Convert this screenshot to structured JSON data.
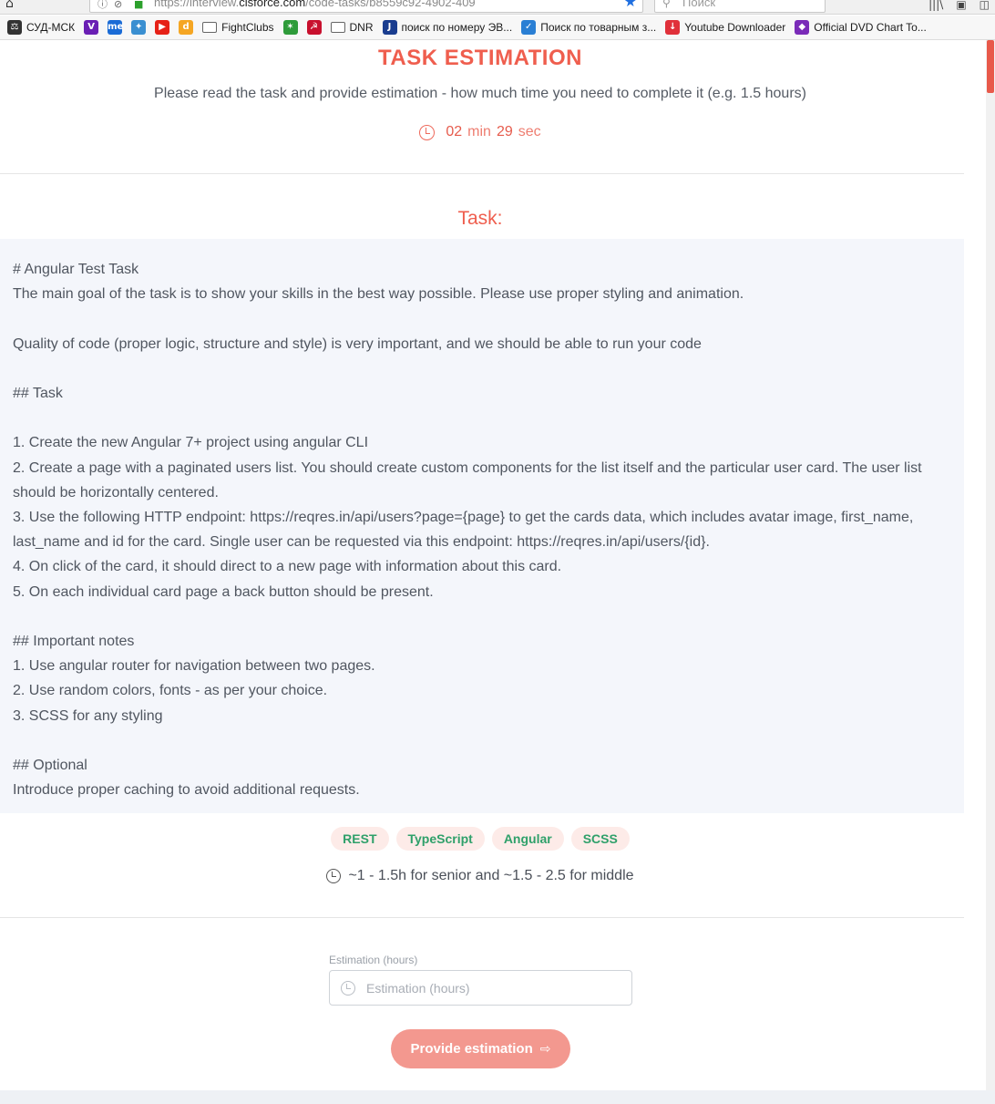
{
  "browser": {
    "url_prefix": "https://interview.",
    "url_domain": "cisforce.com",
    "url_rest": "/code-tasks/b8559c92-4902-409",
    "search_placeholder": "Поиск",
    "bookmarks": [
      {
        "label": "СУД-МСК",
        "icon": "court-icon",
        "color": "#333333"
      },
      {
        "label": "",
        "icon": "vp-icon",
        "color": "#6a1fb4"
      },
      {
        "label": "",
        "icon": "me-icon",
        "color": "#1a6bd6"
      },
      {
        "label": "",
        "icon": "puzzle-icon",
        "color": "#3a8fd1"
      },
      {
        "label": "",
        "icon": "youtube-icon",
        "color": "#e62117"
      },
      {
        "label": "",
        "icon": "d-icon",
        "color": "#f5a623"
      },
      {
        "label": "FightClubs",
        "icon": "folder-icon",
        "color": "#666666"
      },
      {
        "label": "",
        "icon": "star-flag-icon",
        "color": "#2e9b3a"
      },
      {
        "label": "",
        "icon": "emblem-icon",
        "color": "#c8102e"
      },
      {
        "label": "DNR",
        "icon": "folder-icon",
        "color": "#666666"
      },
      {
        "label": "поиск по номеру ЭВ...",
        "icon": "j-icon",
        "color": "#1a3d8f"
      },
      {
        "label": "Поиск по товарным з...",
        "icon": "shield-icon",
        "color": "#2a7fd4"
      },
      {
        "label": "Youtube Downloader",
        "icon": "download-icon",
        "color": "#e0303a"
      },
      {
        "label": "Official DVD Chart To...",
        "icon": "chart-icon",
        "color": "#7a2bb8"
      }
    ]
  },
  "header": {
    "title": "TASK ESTIMATION",
    "subtitle": "Please read the task and provide estimation - how much time you need to complete it (e.g. 1.5 hours)",
    "timer": {
      "minutes": "02",
      "min_label": "min",
      "seconds": "29",
      "sec_label": "sec"
    }
  },
  "task": {
    "label": "Task:",
    "body": "# Angular Test Task\nThe main goal of the task is to show your skills in the best way possible. Please use proper styling and animation.\n\nQuality of code (proper logic, structure and style) is very important, and we should be able to run your code\n\n## Task\n\n1. Create the new Angular 7+ project using angular CLI\n2. Create a page with a paginated users list. You should create custom components for the list itself and the particular user card. The user list should be horizontally centered.\n3. Use the following HTTP endpoint: https://reqres.in/api/users?page={page} to get the cards data, which includes avatar image, first_name, last_name and id for the card. Single user can be requested via this endpoint: https://reqres.in/api/users/{id}.\n4. On click of the card, it should direct to a new page with information about this card.\n5. On each individual card page a back button should be present.\n\n## Important notes\n1. Use angular router for navigation between two pages.\n2. Use random colors, fonts - as per your choice.\n3. SCSS for any styling\n\n## Optional\nIntroduce proper caching to avoid additional requests.",
    "tags": [
      "REST",
      "TypeScript",
      "Angular",
      "SCSS"
    ],
    "hint": "~1 - 1.5h for senior and ~1.5 - 2.5 for middle"
  },
  "form": {
    "label": "Estimation (hours)",
    "placeholder": "Estimation (hours)",
    "value": "",
    "submit_label": "Provide estimation"
  },
  "colors": {
    "accent": "#ef5e4e",
    "button": "#f3988f",
    "tag_bg": "#fdebe8",
    "tag_text": "#2fa06a",
    "task_bg": "#f4f6fb"
  }
}
